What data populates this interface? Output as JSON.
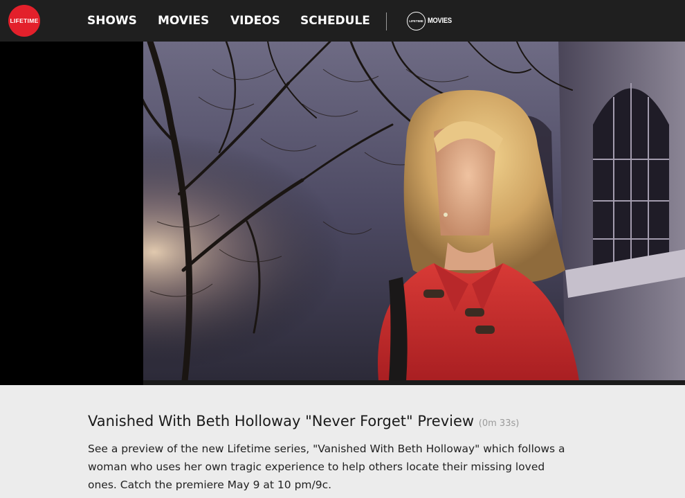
{
  "brand": {
    "logo_text": "LIFETIME",
    "accent_color": "#e3202b"
  },
  "nav": {
    "items": [
      {
        "label": "SHOWS"
      },
      {
        "label": "MOVIES"
      },
      {
        "label": "VIDEOS"
      },
      {
        "label": "SCHEDULE"
      }
    ],
    "lifetime_movies": {
      "circle_text": "LIFETIME",
      "text": "MOVIES"
    }
  },
  "video": {
    "title": "Vanished With Beth Holloway \"Never Forget\" Preview",
    "duration": "(0m 33s)",
    "description": "See a preview of the new Lifetime series, \"Vanished With Beth Holloway\" which follows a woman who uses her own tragic experience to help others locate their missing loved ones. Catch the premiere May 9 at 10 pm/9c."
  }
}
